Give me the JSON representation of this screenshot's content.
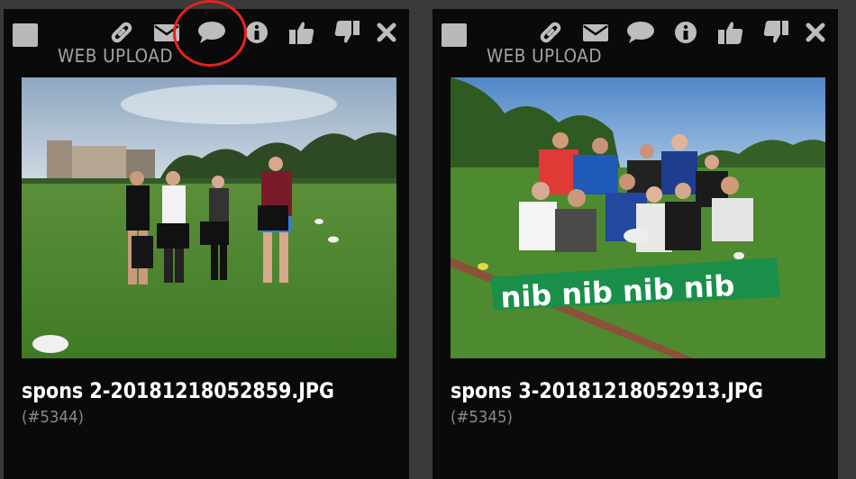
{
  "colors": {
    "card_bg": "#0a0a0a",
    "icon": "#bdbdbd",
    "highlight": "#e8211f",
    "title": "#ffffff",
    "muted": "#8a8a8a"
  },
  "toolbar_icons": [
    "link-icon",
    "envelope-icon",
    "comment-icon",
    "info-icon",
    "thumbs-up-icon",
    "thumbs-down-icon",
    "close-icon"
  ],
  "cards": [
    {
      "source": "WEB UPLOAD",
      "filename": "spons 2-20181218052859.JPG",
      "id": "(#5344)"
    },
    {
      "source": "WEB UPLOAD",
      "filename": "spons 3-20181218052913.JPG",
      "id": "(#5345)"
    }
  ],
  "banner_text": "nib nib nib nib"
}
